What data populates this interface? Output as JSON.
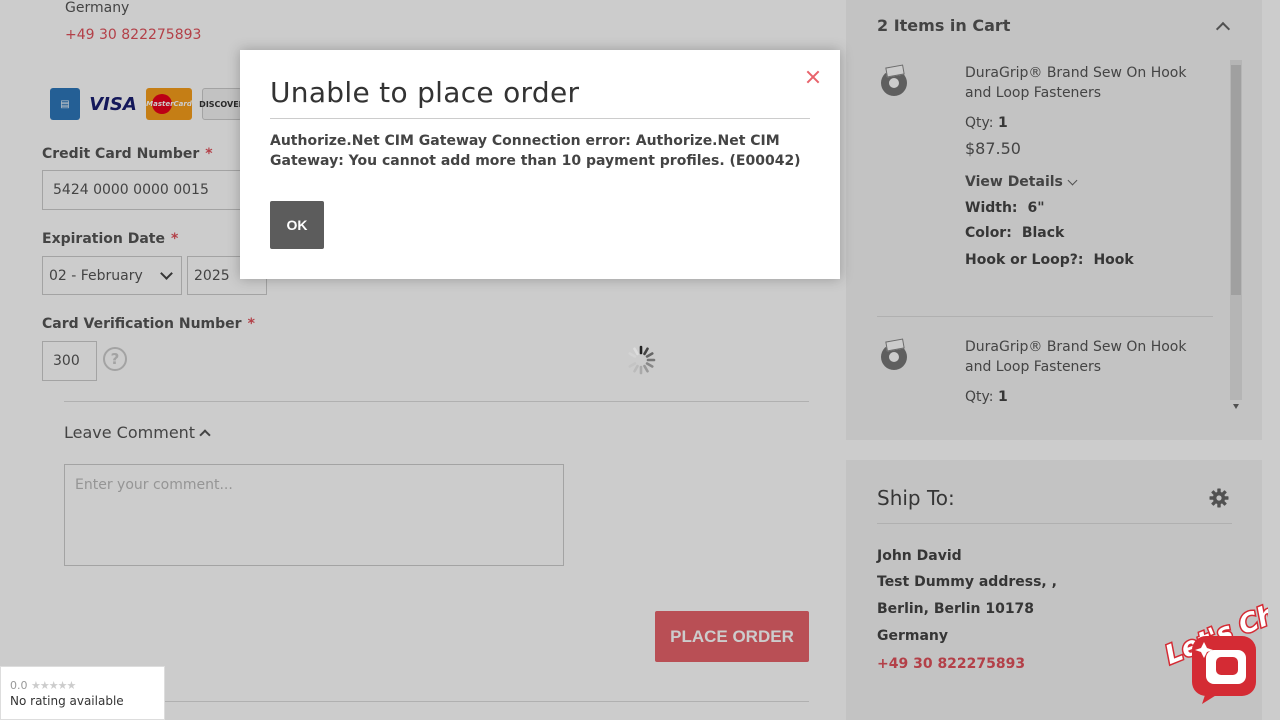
{
  "address": {
    "country": "Germany",
    "phone": "+49 30 822275893"
  },
  "payment": {
    "card_icons": [
      "amex-icon",
      "visa-icon",
      "mastercard-icon",
      "discover-icon"
    ],
    "visa_text": "VISA",
    "mastercard_text": "MasterCard",
    "discover_text": "DISCOVER",
    "card_number_label": "Credit Card Number",
    "card_number_value": "5424 0000 0000 0015",
    "expiration_label": "Expiration Date",
    "exp_month_value": "02 - February",
    "exp_year_value": "2025",
    "cvv_label": "Card Verification Number",
    "cvv_value": "300",
    "required_mark": "*",
    "help_glyph": "?"
  },
  "comment": {
    "label": "Leave Comment",
    "placeholder": "Enter your comment..."
  },
  "place_order_label": "PLACE ORDER",
  "rating": {
    "score": "0.0",
    "stars": "★★★★★",
    "text": "No rating available"
  },
  "cart": {
    "title": "2 Items in Cart",
    "items": [
      {
        "name": "DuraGrip® Brand Sew On Hook and Loop Fasteners",
        "qty_label": "Qty:",
        "qty": "1",
        "price": "$87.50",
        "view_details": "View Details",
        "options": [
          {
            "label": "Width:",
            "value": "6\""
          },
          {
            "label": "Color:",
            "value": "Black"
          },
          {
            "label": "Hook or Loop?:",
            "value": "Hook"
          }
        ]
      },
      {
        "name": "DuraGrip® Brand Sew On Hook and Loop Fasteners",
        "qty_label": "Qty:",
        "qty": "1"
      }
    ]
  },
  "ship_to": {
    "title": "Ship To:",
    "name": "John David",
    "street": "Test Dummy address, ,",
    "city": "Berlin, Berlin 10178",
    "country": "Germany",
    "phone": "+49 30 822275893"
  },
  "modal": {
    "title": "Unable to place order",
    "message": "Authorize.Net CIM Gateway Connection error: Authorize.Net CIM Gateway: You cannot add more than 10 payment profiles. (E00042)",
    "ok_label": "OK"
  },
  "chat_widget": {
    "text": "Let's Chat"
  },
  "colors": {
    "accent": "#e8636b",
    "ok_button": "#5c5c5c",
    "overlay": "rgba(0,0,0,0.2)"
  }
}
